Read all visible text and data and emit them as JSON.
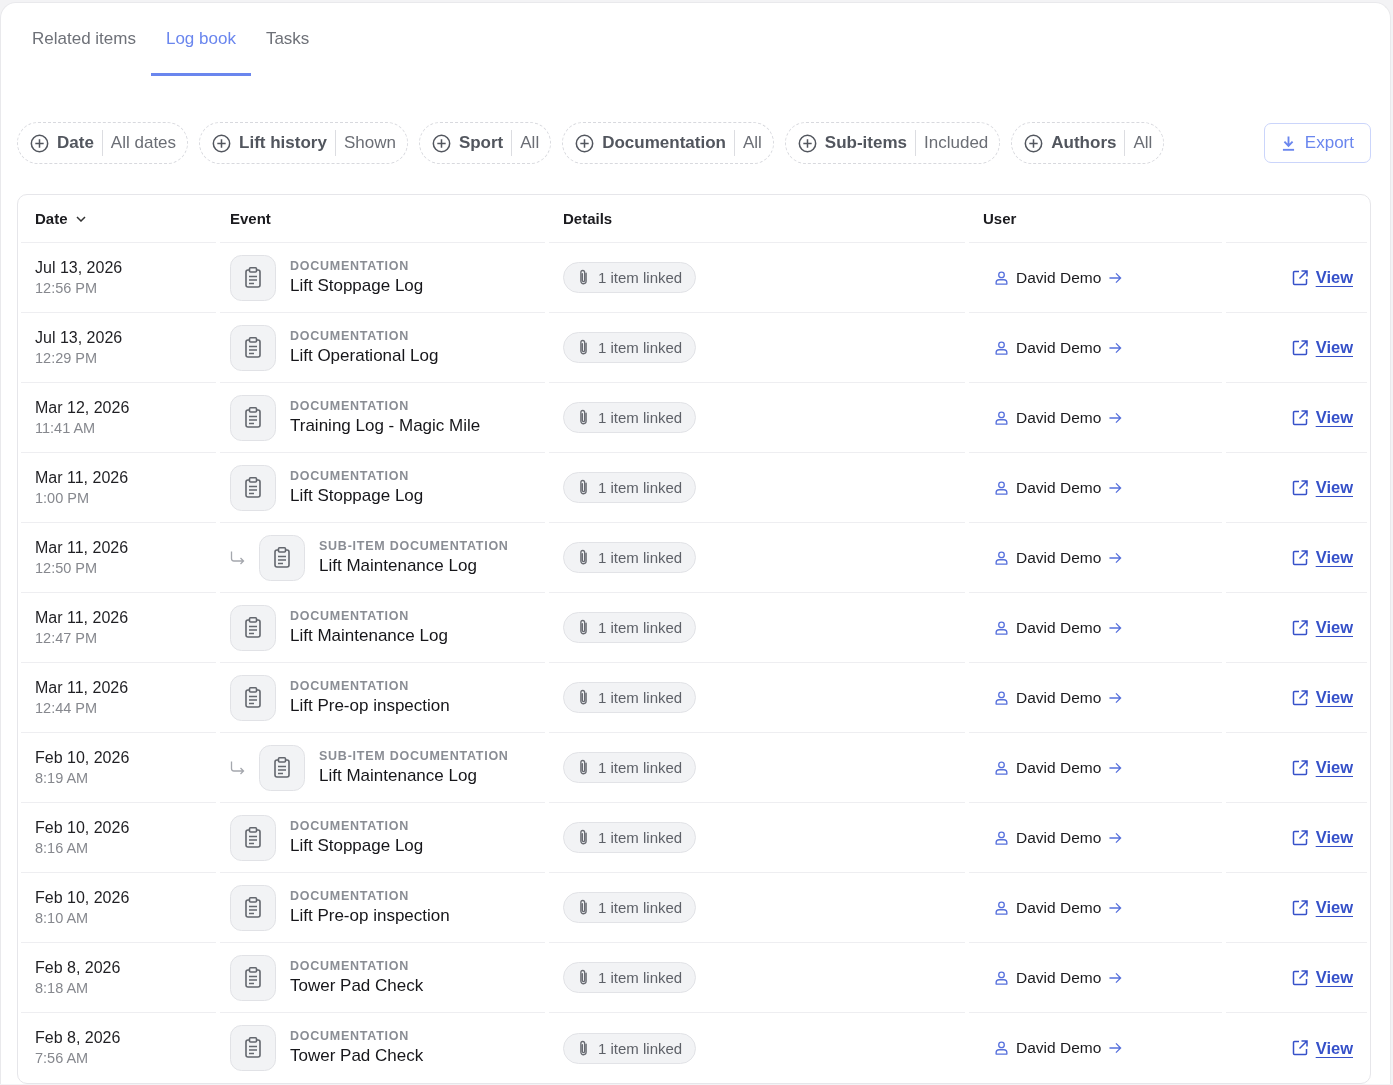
{
  "tabs": [
    {
      "label": "Related items",
      "selected": false
    },
    {
      "label": "Log book",
      "selected": true
    },
    {
      "label": "Tasks",
      "selected": false
    }
  ],
  "filters": [
    {
      "label": "Date",
      "value": "All dates"
    },
    {
      "label": "Lift history",
      "value": "Shown"
    },
    {
      "label": "Sport",
      "value": "All"
    },
    {
      "label": "Documentation",
      "value": "All"
    },
    {
      "label": "Sub-items",
      "value": "Included"
    },
    {
      "label": "Authors",
      "value": "All"
    }
  ],
  "export_button": {
    "label": "Export"
  },
  "table": {
    "columns": [
      {
        "label": "Date",
        "sorted": true
      },
      {
        "label": "Event",
        "sorted": false
      },
      {
        "label": "Details",
        "sorted": false
      },
      {
        "label": "User",
        "sorted": false
      }
    ],
    "rows": [
      {
        "date": "Jul 13, 2026",
        "time": "12:56 PM",
        "sub_item": false,
        "category": "DOCUMENTATION",
        "title": "Lift Stoppage Log",
        "details": "1 item linked",
        "user": "David Demo",
        "action": "View"
      },
      {
        "date": "Jul 13, 2026",
        "time": "12:29 PM",
        "sub_item": false,
        "category": "DOCUMENTATION",
        "title": "Lift Operational Log",
        "details": "1 item linked",
        "user": "David Demo",
        "action": "View"
      },
      {
        "date": "Mar 12, 2026",
        "time": "11:41 AM",
        "sub_item": false,
        "category": "DOCUMENTATION",
        "title": "Training Log - Magic Mile",
        "details": "1 item linked",
        "user": "David Demo",
        "action": "View"
      },
      {
        "date": "Mar 11, 2026",
        "time": "1:00 PM",
        "sub_item": false,
        "category": "DOCUMENTATION",
        "title": "Lift Stoppage Log",
        "details": "1 item linked",
        "user": "David Demo",
        "action": "View"
      },
      {
        "date": "Mar 11, 2026",
        "time": "12:50 PM",
        "sub_item": true,
        "category": "SUB-ITEM DOCUMENTATION",
        "title": "Lift Maintenance Log",
        "details": "1 item linked",
        "user": "David Demo",
        "action": "View"
      },
      {
        "date": "Mar 11, 2026",
        "time": "12:47 PM",
        "sub_item": false,
        "category": "DOCUMENTATION",
        "title": "Lift Maintenance Log",
        "details": "1 item linked",
        "user": "David Demo",
        "action": "View"
      },
      {
        "date": "Mar 11, 2026",
        "time": "12:44 PM",
        "sub_item": false,
        "category": "DOCUMENTATION",
        "title": "Lift Pre-op inspection",
        "details": "1 item linked",
        "user": "David Demo",
        "action": "View"
      },
      {
        "date": "Feb 10, 2026",
        "time": "8:19 AM",
        "sub_item": true,
        "category": "SUB-ITEM DOCUMENTATION",
        "title": "Lift Maintenance Log",
        "details": "1 item linked",
        "user": "David Demo",
        "action": "View"
      },
      {
        "date": "Feb 10, 2026",
        "time": "8:16 AM",
        "sub_item": false,
        "category": "DOCUMENTATION",
        "title": "Lift Stoppage Log",
        "details": "1 item linked",
        "user": "David Demo",
        "action": "View"
      },
      {
        "date": "Feb 10, 2026",
        "time": "8:10 AM",
        "sub_item": false,
        "category": "DOCUMENTATION",
        "title": "Lift Pre-op inspection",
        "details": "1 item linked",
        "user": "David Demo",
        "action": "View"
      },
      {
        "date": "Feb 8, 2026",
        "time": "8:18 AM",
        "sub_item": false,
        "category": "DOCUMENTATION",
        "title": "Tower Pad Check",
        "details": "1 item linked",
        "user": "David Demo",
        "action": "View"
      },
      {
        "date": "Feb 8, 2026",
        "time": "7:56 AM",
        "sub_item": false,
        "category": "DOCUMENTATION",
        "title": "Tower Pad Check",
        "details": "1 item linked",
        "user": "David Demo",
        "action": "View"
      }
    ]
  }
}
